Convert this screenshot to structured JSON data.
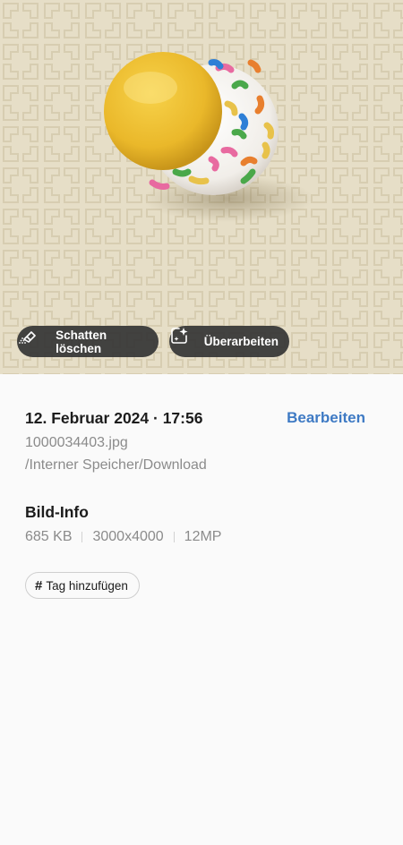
{
  "photo": {
    "alt_icon": "photo-ball-image",
    "actions": [
      {
        "label": "Schatten löschen",
        "icon": "eraser-icon"
      },
      {
        "label": "Überarbeiten",
        "icon": "sparkle-edit-icon"
      }
    ]
  },
  "details": {
    "date": "12. Februar 2024 · 17:56",
    "edit_label": "Bearbeiten",
    "filename": "1000034403.jpg",
    "path": "/Interner Speicher/Download",
    "info_title": "Bild-Info",
    "size": "685 KB",
    "resolution": "3000x4000",
    "megapixels": "12MP",
    "tag_label": "Tag hinzufügen"
  },
  "colors": {
    "accent": "#3e7ac4",
    "chip_bg": "#343434",
    "page_bg": "#fafafa"
  }
}
